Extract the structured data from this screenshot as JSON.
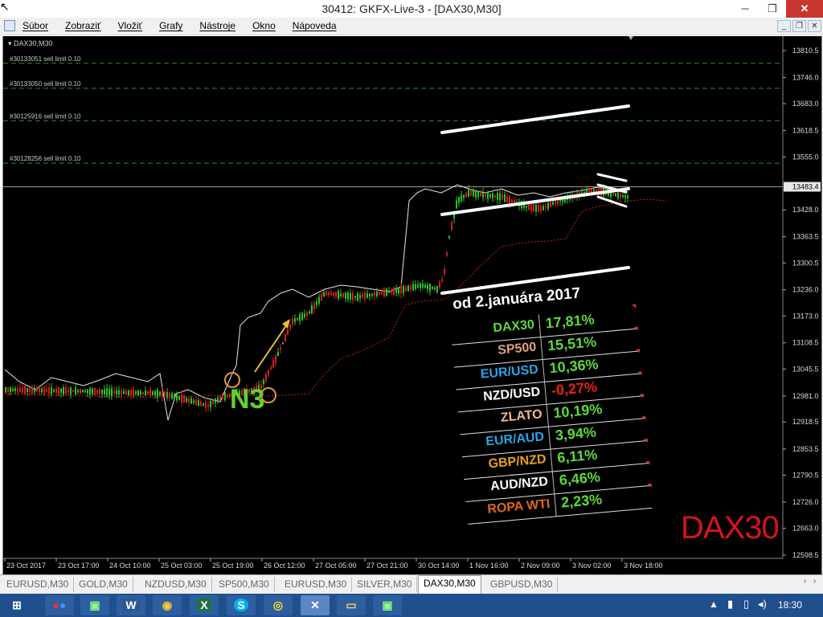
{
  "window": {
    "title": "30412: GKFX-Live-3 - [DAX30,M30]"
  },
  "menu": {
    "items": [
      "Súbor",
      "Zobraziť",
      "Vložiť",
      "Grafy",
      "Nástroje",
      "Okno",
      "Nápoveda"
    ]
  },
  "chart": {
    "symbol_label": "DAX30,M30",
    "watermark": "DAX30",
    "annotation": "N3",
    "orders": [
      {
        "label": "#30133051 sell limit 0.10",
        "price": 13780
      },
      {
        "label": "#30133050 sell limit 0.10",
        "price": 13720
      },
      {
        "label": "#30125916 sell limit 0.10",
        "price": 13642
      },
      {
        "label": "#30128256 sell limit 0.10",
        "price": 13540
      }
    ],
    "current_price": "13483.4",
    "price_axis": [
      "13810.5",
      "13746.0",
      "13683.0",
      "13618.5",
      "13555.0",
      "13428.0",
      "13363.5",
      "13300.5",
      "13236.0",
      "13173.0",
      "13108.5",
      "13045.5",
      "12981.0",
      "12918.5",
      "12853.5",
      "12790.5",
      "12726.0",
      "12663.0",
      "12598.5"
    ],
    "time_axis": [
      "23 Oct 2017",
      "23 Oct 17:00",
      "24 Oct 10:00",
      "25 Oct 03:00",
      "25 Oct 19:00",
      "26 Oct 12:00",
      "27 Oct 05:00",
      "27 Oct 21:00",
      "30 Oct 14:00",
      "1 Nov 16:00",
      "2 Nov 09:00",
      "3 Nov 02:00",
      "3 Nov 18:00"
    ]
  },
  "performance": {
    "title": "od 2.januára 2017",
    "rows": [
      {
        "name": "DAX30",
        "value": "17,81%",
        "name_color": "#5fd83a",
        "value_color": "#5fd83a"
      },
      {
        "name": "SP500",
        "value": "15,51%",
        "name_color": "#e0a07a",
        "value_color": "#5fd83a"
      },
      {
        "name": "EUR/USD",
        "value": "10,36%",
        "name_color": "#2aa4e8",
        "value_color": "#5fd83a"
      },
      {
        "name": "NZD/USD",
        "value": "-0,27%",
        "name_color": "#ffffff",
        "value_color": "#e8201c"
      },
      {
        "name": "ZLATO",
        "value": "10,19%",
        "name_color": "#f0b890",
        "value_color": "#5fd83a"
      },
      {
        "name": "EUR/AUD",
        "value": "3,94%",
        "name_color": "#2aa4e8",
        "value_color": "#5fd83a"
      },
      {
        "name": "GBP/NZD",
        "value": "6,11%",
        "name_color": "#e8a020",
        "value_color": "#5fd83a"
      },
      {
        "name": "AUD/NZD",
        "value": "6,46%",
        "name_color": "#ffffff",
        "value_color": "#5fd83a"
      },
      {
        "name": "ROPA WTI",
        "value": "2,23%",
        "name_color": "#e06818",
        "value_color": "#5fd83a"
      }
    ]
  },
  "tabs": {
    "items": [
      "EURUSD,M30",
      "GOLD,M30",
      "NZDUSD,M30",
      "SP500,M30",
      "EURUSD,M30",
      "SILVER,M30",
      "DAX30,M30",
      "GBPUSD,M30"
    ],
    "active_index": 6
  },
  "taskbar": {
    "icons": [
      "windows-start",
      "app-mixed",
      "app-generic",
      "word",
      "app-globe",
      "excel",
      "skype",
      "chrome",
      "metatrader",
      "file-explorer",
      "app-other"
    ],
    "clock": "18:30"
  },
  "colors": {
    "bull": "#2ec22e",
    "bear": "#d42020",
    "support": "#c81e1e",
    "overlay": "#ffffff"
  }
}
